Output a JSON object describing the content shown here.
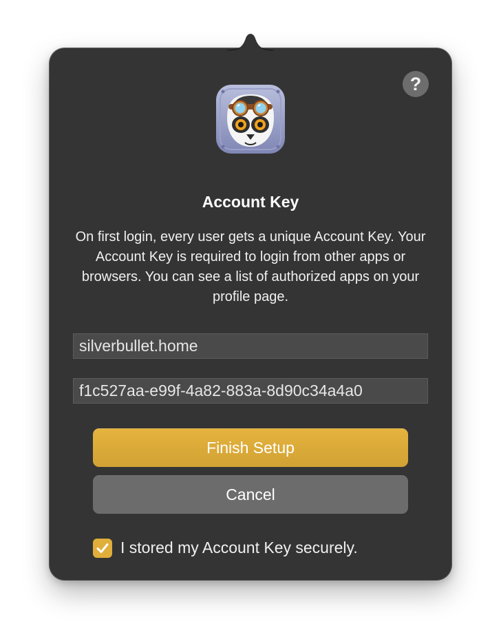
{
  "dialog": {
    "help_icon": "?",
    "app_icon": "lemur-with-goggles-app-icon",
    "title": "Account Key",
    "description": "On first login, every user gets a unique Account Key. Your Account Key is required to login from other apps or browsers. You can see a list of authorized apps on your profile page.",
    "host_field": {
      "value": "silverbullet.home"
    },
    "key_field": {
      "value": "f1c527aa-e99f-4a82-883a-8d90c34a4a0"
    },
    "finish_button": "Finish Setup",
    "cancel_button": "Cancel",
    "checkbox": {
      "checked": true,
      "label": "I stored my Account Key securely."
    }
  },
  "colors": {
    "panel": "#343434",
    "accent": "#e0ae3a",
    "secondary_button": "#6c6c6c",
    "field": "#4a4a4a"
  }
}
